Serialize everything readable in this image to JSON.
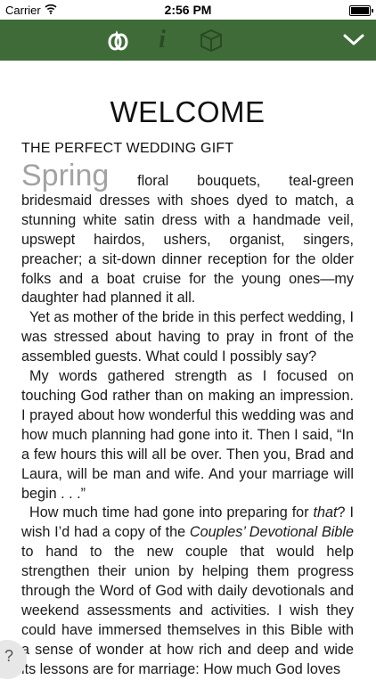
{
  "status_bar": {
    "carrier": "Carrier",
    "time": "2:56 PM"
  },
  "toolbar": {
    "icons": [
      "rings-icon",
      "info-icon",
      "box-icon",
      "chevron-down-icon"
    ],
    "info_glyph": "i",
    "accent_color": "#3e6b37"
  },
  "article": {
    "title": "WELCOME",
    "subtitle": "THE PERFECT WEDDING GIFT",
    "drop_word": "Spring",
    "p1_rest": " floral bouquets, teal-green bridesmaid dresses with shoes dyed to match, a stunning white satin dress with a handmade veil, upswept hairdos, ushers, organist, singers, preacher; a sit-down dinner reception for the older folks and a boat cruise for the young ones—my daughter had planned it all.",
    "p2": "Yet as mother of the bride in this perfect wedding, I was stressed about having to pray in front of the assembled guests. What could I possibly say?",
    "p3": "My words gathered strength as I focused on touching God rather than on making an impression. I prayed about how wonderful this wedding was and how much planning had gone into it. Then I said, “In a few hours this will all be over. Then you, Brad and Laura, will be man and wife. And your marriage will begin . . .”",
    "p4_a": "How much time had gone into preparing for ",
    "p4_em1": "that",
    "p4_b": "? I wish I’d had a copy of the ",
    "p4_em2": "Couples’ Devotional Bible",
    "p4_c": " to hand to the new couple that would help strengthen their union by helping them progress through the Word of God with daily devotionals and weekend assessments and activities. I wish they could have immersed themselves in this Bible with a sense of wonder at how rich and deep and wide its lessons are for marriage: How much God loves"
  },
  "help": {
    "glyph": "?"
  }
}
